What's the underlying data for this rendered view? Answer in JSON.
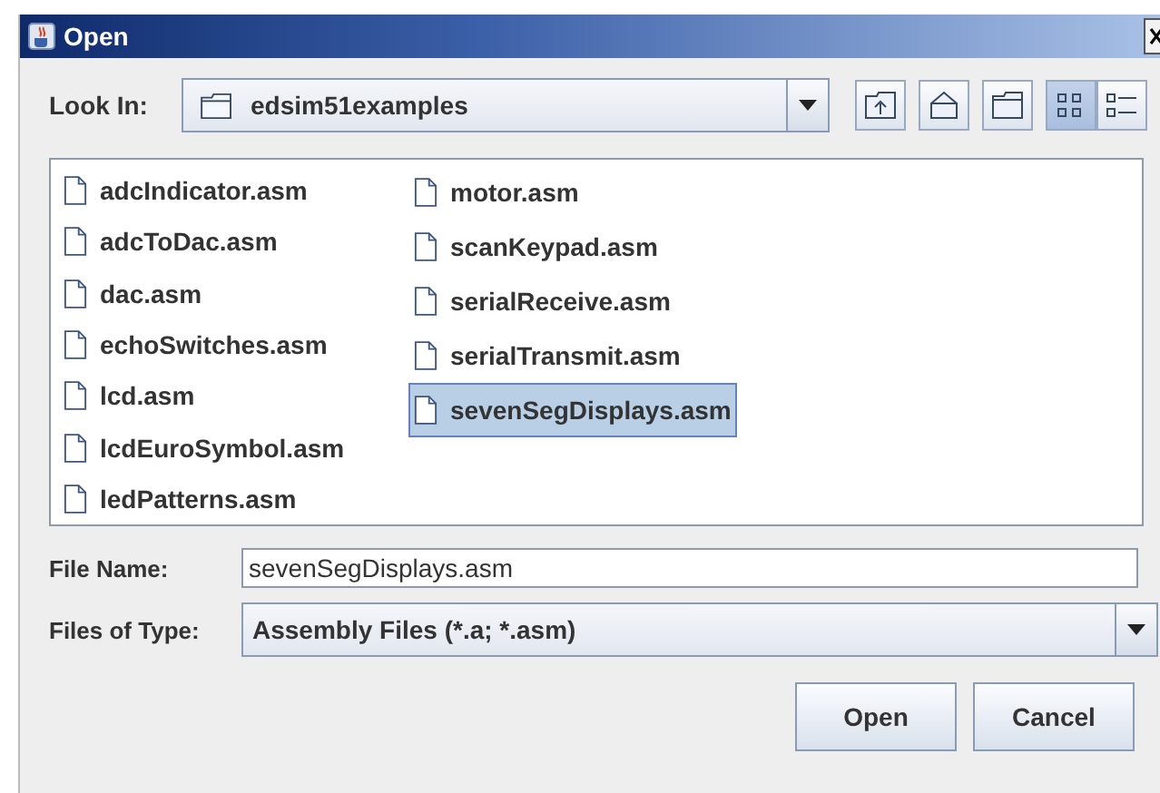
{
  "window": {
    "title": "Open"
  },
  "look_in": {
    "label": "Look In:",
    "value": "edsim51examples"
  },
  "toolbar": [
    {
      "kind": "up"
    },
    {
      "kind": "home"
    },
    {
      "kind": "new-folder"
    },
    {
      "kind": "list",
      "selected": true
    },
    {
      "kind": "details",
      "selected": false
    }
  ],
  "files": {
    "columns": [
      [
        {
          "name": "adcIndicator.asm",
          "selected": false
        },
        {
          "name": "adcToDac.asm",
          "selected": false
        },
        {
          "name": "dac.asm",
          "selected": false
        },
        {
          "name": "echoSwitches.asm",
          "selected": false
        },
        {
          "name": "lcd.asm",
          "selected": false
        },
        {
          "name": "lcdEuroSymbol.asm",
          "selected": false
        },
        {
          "name": "ledPatterns.asm",
          "selected": false
        }
      ],
      [
        {
          "name": "motor.asm",
          "selected": false
        },
        {
          "name": "scanKeypad.asm",
          "selected": false
        },
        {
          "name": "serialReceive.asm",
          "selected": false
        },
        {
          "name": "serialTransmit.asm",
          "selected": false
        },
        {
          "name": "sevenSegDisplays.asm",
          "selected": true
        }
      ]
    ]
  },
  "file_name": {
    "label": "File Name:",
    "value": "sevenSegDisplays.asm"
  },
  "file_type": {
    "label": "Files of Type:",
    "value": "Assembly Files (*.a; *.asm)"
  },
  "buttons": [
    "Open",
    "Cancel"
  ]
}
